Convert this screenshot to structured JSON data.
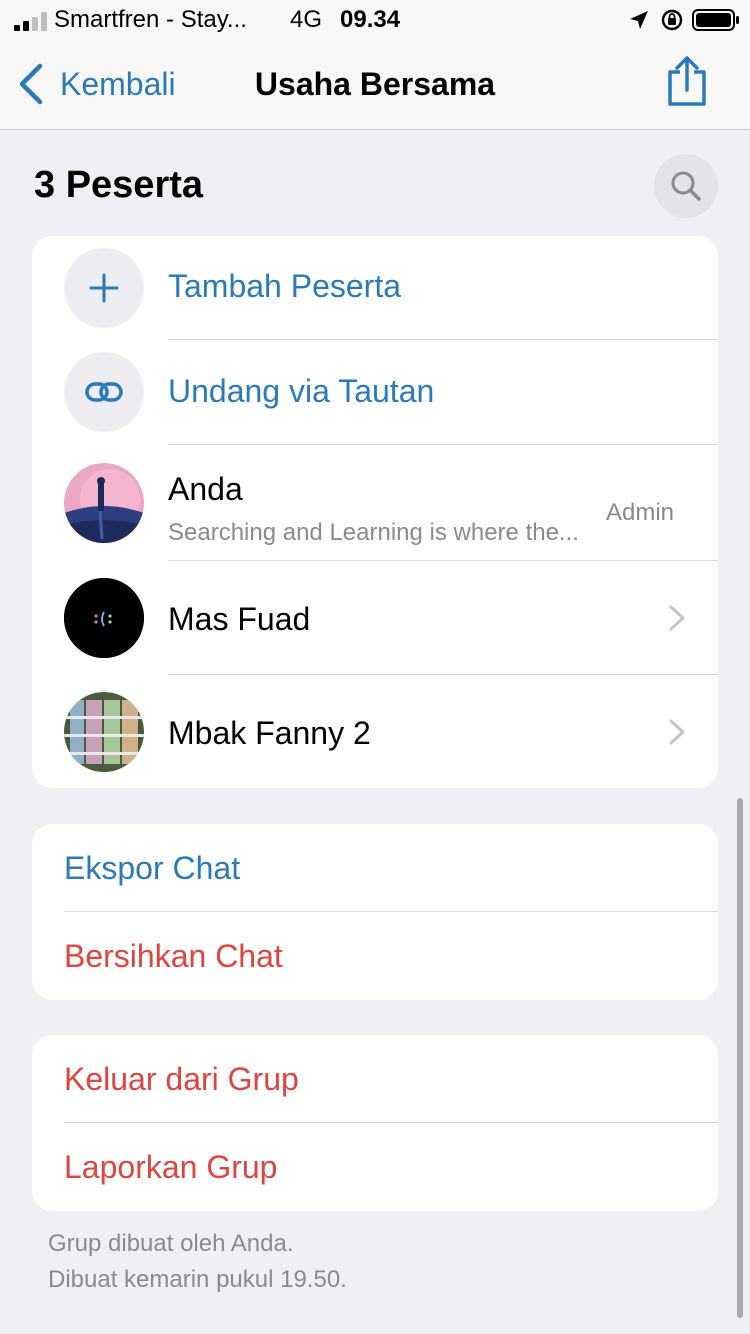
{
  "status_bar": {
    "carrier": "Smartfren - Stay...",
    "network": "4G",
    "time": "09.34",
    "icons": [
      "signal-icon",
      "location-icon",
      "orientation-lock-icon",
      "battery-icon"
    ]
  },
  "nav": {
    "back_label": "Kembali",
    "title": "Usaha Bersama",
    "share_icon": "share-icon"
  },
  "participants": {
    "header": "3 Peserta",
    "add_label": "Tambah Peserta",
    "invite_label": "Undang via Tautan",
    "members": [
      {
        "name": "Anda",
        "subtitle": "Searching and Learning is where the...",
        "role": "Admin"
      },
      {
        "name": "Mas Fuad"
      },
      {
        "name": "Mbak Fanny 2"
      }
    ]
  },
  "chat_actions": {
    "export_label": "Ekspor Chat",
    "clear_label": "Bersihkan Chat"
  },
  "group_actions": {
    "leave_label": "Keluar dari Grup",
    "report_label": "Laporkan Grup"
  },
  "footer": {
    "line1": "Grup dibuat oleh Anda.",
    "line2": "Dibuat kemarin pukul 19.50."
  },
  "colors": {
    "accent_blue": "#2b7ab8",
    "destructive_red": "#e0443e",
    "background": "#efeff4"
  }
}
